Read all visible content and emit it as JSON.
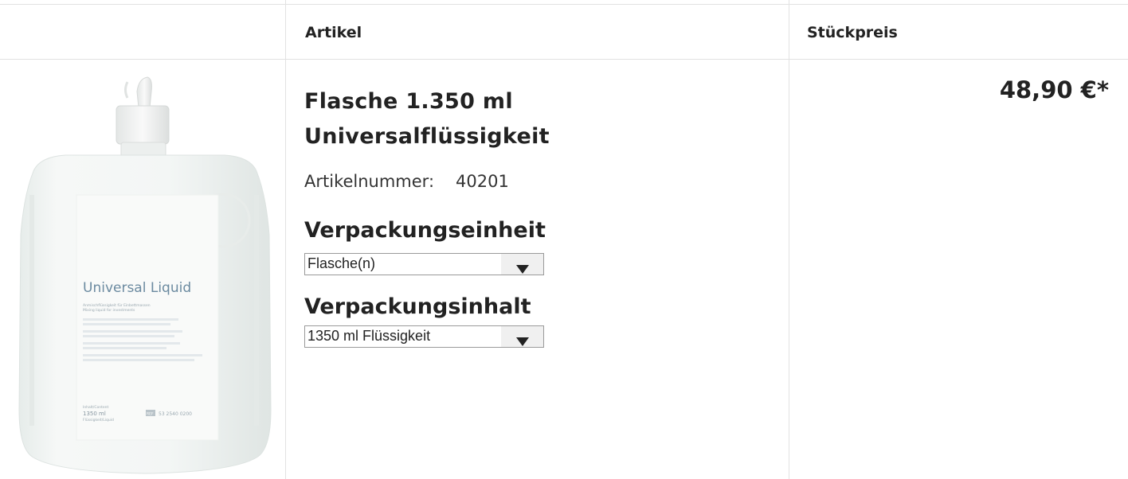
{
  "header": {
    "col_article": "Artikel",
    "col_unit_price": "Stückpreis"
  },
  "product": {
    "title_line1": "Flasche 1.350 ml",
    "title_line2": "Universalflüssigkeit",
    "sku_label": "Artikelnummer:",
    "sku_value": "40201",
    "price": "48,90 €*",
    "image": {
      "label_title": "Universal Liquid",
      "label_sub1": "Anmischflüssigkeit für Einbettmassen",
      "label_sub2": "Mixing liquid for investments",
      "content_label": "Inhalt/Content",
      "content_value": "1350 ml",
      "content_sub": "Flüssigkeit/Liquid",
      "ref_badge": "REF",
      "ref_value": "53 2540 0200"
    }
  },
  "options": {
    "packaging_unit": {
      "label": "Verpackungseinheit",
      "selected": "Flasche(n)"
    },
    "packaging_content": {
      "label": "Verpackungsinhalt",
      "selected": "1350 ml Flüssigkeit"
    }
  }
}
